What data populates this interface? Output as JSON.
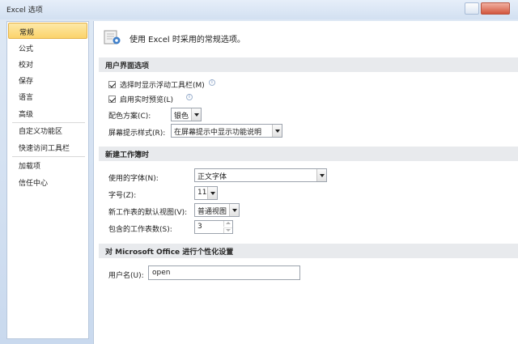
{
  "window": {
    "title": "Excel 选项"
  },
  "sidebar": {
    "items": [
      {
        "label": "常规"
      },
      {
        "label": "公式"
      },
      {
        "label": "校对"
      },
      {
        "label": "保存"
      },
      {
        "label": "语言"
      },
      {
        "label": "高级"
      },
      {
        "label": "自定义功能区"
      },
      {
        "label": "快速访问工具栏"
      },
      {
        "label": "加载项"
      },
      {
        "label": "信任中心"
      }
    ],
    "selected": "常规"
  },
  "main": {
    "header": "使用 Excel 时采用的常规选项。",
    "ui_section": {
      "title": "用户界面选项",
      "mini_toolbar": {
        "label": "选择时显示浮动工具栏(M)",
        "checked": true
      },
      "live_preview": {
        "label": "启用实时预览(L)",
        "checked": true
      },
      "color_scheme": {
        "label": "配色方案(C):",
        "value": "银色"
      },
      "screentip": {
        "label": "屏幕提示样式(R):",
        "value": "在屏幕提示中显示功能说明"
      }
    },
    "new_wb_section": {
      "title": "新建工作簿时",
      "font": {
        "label": "使用的字体(N):",
        "value": "正文字体"
      },
      "font_size": {
        "label": "字号(Z):",
        "value": "11"
      },
      "default_view": {
        "label": "新工作表的默认视图(V):",
        "value": "普通视图"
      },
      "sheet_count": {
        "label": "包含的工作表数(S):",
        "value": "3"
      }
    },
    "personalize_section": {
      "title": "对 Microsoft Office 进行个性化设置",
      "username": {
        "label": "用户名(U):",
        "value": "open"
      }
    }
  },
  "colors": {
    "selected_item": "#fbd36b",
    "section_bg": "#e8eaed",
    "frame": "#c9d9ee"
  }
}
